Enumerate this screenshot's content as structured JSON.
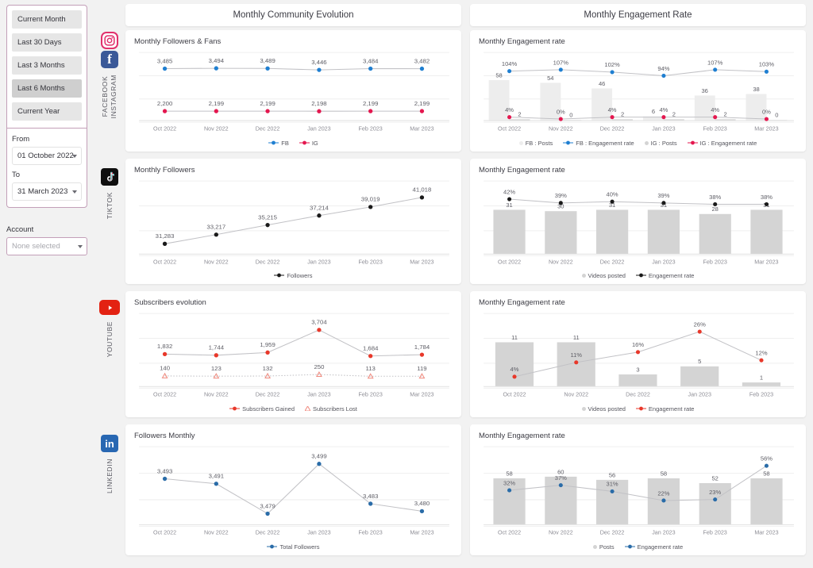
{
  "sidebar": {
    "ranges": [
      {
        "label": "Current Month",
        "active": false
      },
      {
        "label": "Last 30 Days",
        "active": false
      },
      {
        "label": "Last 3 Months",
        "active": false
      },
      {
        "label": "Last 6 Months",
        "active": true
      },
      {
        "label": "Current Year",
        "active": false
      }
    ],
    "from_label": "From",
    "from_value": "01 October 2022",
    "to_label": "To",
    "to_value": "31 March 2023",
    "account_label": "Account",
    "account_value": "None selected"
  },
  "rail": [
    {
      "key": "fbig",
      "icons": [
        "instagram-icon",
        "facebook-icon"
      ],
      "label": "FACEBOOK\nINSTAGRAM"
    },
    {
      "key": "tiktok",
      "icons": [
        "tiktok-icon"
      ],
      "label": "TIKTOK"
    },
    {
      "key": "youtube",
      "icons": [
        "youtube-icon"
      ],
      "label": "YOUTUBE"
    },
    {
      "key": "linkedin",
      "icons": [
        "linkedin-icon"
      ],
      "label": "LINKEDIN"
    }
  ],
  "columns": {
    "left_title": "Monthly Community Evolution",
    "right_title": "Monthly Engagement Rate"
  },
  "colors": {
    "facebook_blue": "#1f7fd1",
    "instagram_pink": "#e4174f",
    "youtube_red": "#e8382a",
    "linkedin_blue": "#2a6ca8",
    "tiktok_black": "#1a1a1a",
    "bar_grey": "#d4d4d4",
    "line_grey": "#b9b9bd",
    "accent_purple": "#c39fb8"
  },
  "chart_data": [
    {
      "id": "fbig-community",
      "type": "line",
      "title": "Monthly Followers & Fans",
      "xlabel": "",
      "ylabel": "",
      "grid": true,
      "legend_position": "bottom",
      "categories": [
        "Oct 2022",
        "Nov 2022",
        "Dec 2022",
        "Jan 2023",
        "Feb 2023",
        "Mar 2023"
      ],
      "series": [
        {
          "name": "FB",
          "color": "#1f7fd1",
          "values": [
            3485,
            3494,
            3489,
            3446,
            3484,
            3482
          ],
          "labels": [
            "3,485",
            "3,494",
            "3,489",
            "3,446",
            "3,484",
            "3,482"
          ]
        },
        {
          "name": "IG",
          "color": "#e4174f",
          "values": [
            2200,
            2199,
            2199,
            2198,
            2199,
            2199
          ],
          "labels": [
            "2,200",
            "2,199",
            "2,199",
            "2,198",
            "2,199",
            "2,199"
          ]
        }
      ]
    },
    {
      "id": "fbig-engagement",
      "type": "bar+line",
      "title": "Monthly Engagement rate",
      "xlabel": "",
      "ylabel": "",
      "grid": true,
      "legend_position": "bottom",
      "categories": [
        "Oct 2022",
        "Nov 2022",
        "Dec 2022",
        "Jan 2023",
        "Feb 2023",
        "Mar 2023"
      ],
      "series": [
        {
          "name": "FB : Posts",
          "kind": "bar",
          "color": "#ededed",
          "values": [
            58,
            54,
            46,
            6,
            36,
            38
          ],
          "labels": [
            "58",
            "54",
            "46",
            "6",
            "36",
            "38"
          ]
        },
        {
          "name": "FB : Engagement rate",
          "kind": "line",
          "color": "#1f7fd1",
          "values": [
            104,
            107,
            102,
            94,
            107,
            103
          ],
          "labels": [
            "104%",
            "107%",
            "102%",
            "94%",
            "107%",
            "103%"
          ]
        },
        {
          "name": "IG : Posts",
          "kind": "bar",
          "color": "#d4d4d4",
          "values": [
            2,
            0,
            2,
            2,
            2,
            0
          ],
          "labels": [
            "2",
            "0",
            "2",
            "2",
            "2",
            "0"
          ]
        },
        {
          "name": "IG : Engagement rate",
          "kind": "line",
          "color": "#e4174f",
          "values": [
            4,
            0,
            4,
            4,
            4,
            0
          ],
          "labels": [
            "4%",
            "0%",
            "4%",
            "4%",
            "4%",
            "0%"
          ]
        }
      ]
    },
    {
      "id": "tiktok-community",
      "type": "line",
      "title": "Monthly Followers",
      "xlabel": "",
      "ylabel": "",
      "grid": true,
      "legend_position": "bottom",
      "categories": [
        "Oct 2022",
        "Nov 2022",
        "Dec 2022",
        "Jan 2023",
        "Feb 2023",
        "Mar 2023"
      ],
      "series": [
        {
          "name": "Followers",
          "color": "#1a1a1a",
          "values": [
            31283,
            33217,
            35215,
            37214,
            39019,
            41018
          ],
          "labels": [
            "31,283",
            "33,217",
            "35,215",
            "37,214",
            "39,019",
            "41,018"
          ]
        }
      ]
    },
    {
      "id": "tiktok-engagement",
      "type": "bar+line",
      "title": "Monthly Engagement rate",
      "xlabel": "",
      "ylabel": "",
      "grid": true,
      "legend_position": "bottom",
      "categories": [
        "Oct 2022",
        "Nov 2022",
        "Dec 2022",
        "Jan 2023",
        "Feb 2023",
        "Mar 2023"
      ],
      "series": [
        {
          "name": "Videos posted",
          "kind": "bar",
          "color": "#d4d4d4",
          "values": [
            31,
            30,
            31,
            31,
            28,
            31
          ],
          "labels": [
            "31",
            "30",
            "31",
            "31",
            "28",
            "31"
          ]
        },
        {
          "name": "Engagement rate",
          "kind": "line",
          "color": "#1a1a1a",
          "values": [
            42,
            39,
            40,
            39,
            38,
            38
          ],
          "labels": [
            "42%",
            "39%",
            "40%",
            "39%",
            "38%",
            "38%"
          ]
        }
      ]
    },
    {
      "id": "youtube-community",
      "type": "line",
      "title": "Subscribers evolution",
      "xlabel": "",
      "ylabel": "",
      "grid": true,
      "legend_position": "bottom",
      "categories": [
        "Oct 2022",
        "Nov 2022",
        "Dec 2022",
        "Jan 2023",
        "Feb 2023",
        "Mar 2023"
      ],
      "series": [
        {
          "name": "Subscribers Gained",
          "color": "#e8382a",
          "values": [
            1832,
            1744,
            1959,
            3704,
            1684,
            1784
          ],
          "labels": [
            "1,832",
            "1,744",
            "1,959",
            "3,704",
            "1,684",
            "1,784"
          ]
        },
        {
          "name": "Subscribers Lost",
          "color": "#f08a7e",
          "values": [
            140,
            123,
            132,
            250,
            113,
            119
          ],
          "labels": [
            "140",
            "123",
            "132",
            "250",
            "113",
            "119"
          ]
        }
      ]
    },
    {
      "id": "youtube-engagement",
      "type": "bar+line",
      "title": "Monthly Engagement rate",
      "xlabel": "",
      "ylabel": "",
      "grid": true,
      "legend_position": "bottom",
      "categories": [
        "Oct 2022",
        "Nov 2022",
        "Dec 2022",
        "Jan 2023",
        "Feb 2023"
      ],
      "series": [
        {
          "name": "Videos posted",
          "kind": "bar",
          "color": "#d4d4d4",
          "values": [
            11,
            11,
            3,
            5,
            1
          ],
          "labels": [
            "11",
            "11",
            "3",
            "5",
            "1"
          ]
        },
        {
          "name": "Engagement rate",
          "kind": "line",
          "color": "#e8382a",
          "values": [
            4,
            11,
            16,
            26,
            12
          ],
          "labels": [
            "4%",
            "11%",
            "16%",
            "26%",
            "12%"
          ]
        }
      ]
    },
    {
      "id": "linkedin-community",
      "type": "line",
      "title": "Followers Monthly",
      "xlabel": "",
      "ylabel": "",
      "grid": true,
      "legend_position": "bottom",
      "categories": [
        "Oct 2022",
        "Nov 2022",
        "Dec 2022",
        "Jan 2023",
        "Feb 2023",
        "Mar 2023"
      ],
      "series": [
        {
          "name": "Total Followers",
          "color": "#2a6ca8",
          "values": [
            3493,
            3491,
            3479,
            3499,
            3483,
            3480
          ],
          "labels": [
            "3,493",
            "3,491",
            "3,479",
            "3,499",
            "3,483",
            "3,480"
          ]
        }
      ]
    },
    {
      "id": "linkedin-engagement",
      "type": "bar+line",
      "title": "Monthly Engagement rate",
      "xlabel": "",
      "ylabel": "",
      "grid": true,
      "legend_position": "bottom",
      "categories": [
        "Oct 2022",
        "Nov 2022",
        "Dec 2022",
        "Jan 2023",
        "Feb 2023",
        "Mar 2023"
      ],
      "series": [
        {
          "name": "Posts",
          "kind": "bar",
          "color": "#d4d4d4",
          "values": [
            58,
            60,
            56,
            58,
            52,
            58
          ],
          "labels": [
            "58",
            "60",
            "56",
            "58",
            "52",
            "58"
          ]
        },
        {
          "name": "Engagement rate",
          "kind": "line",
          "color": "#2a6ca8",
          "values": [
            32,
            37,
            31,
            22,
            23,
            56
          ],
          "labels": [
            "32%",
            "37%",
            "31%",
            "22%",
            "23%",
            "56%"
          ]
        }
      ]
    }
  ]
}
